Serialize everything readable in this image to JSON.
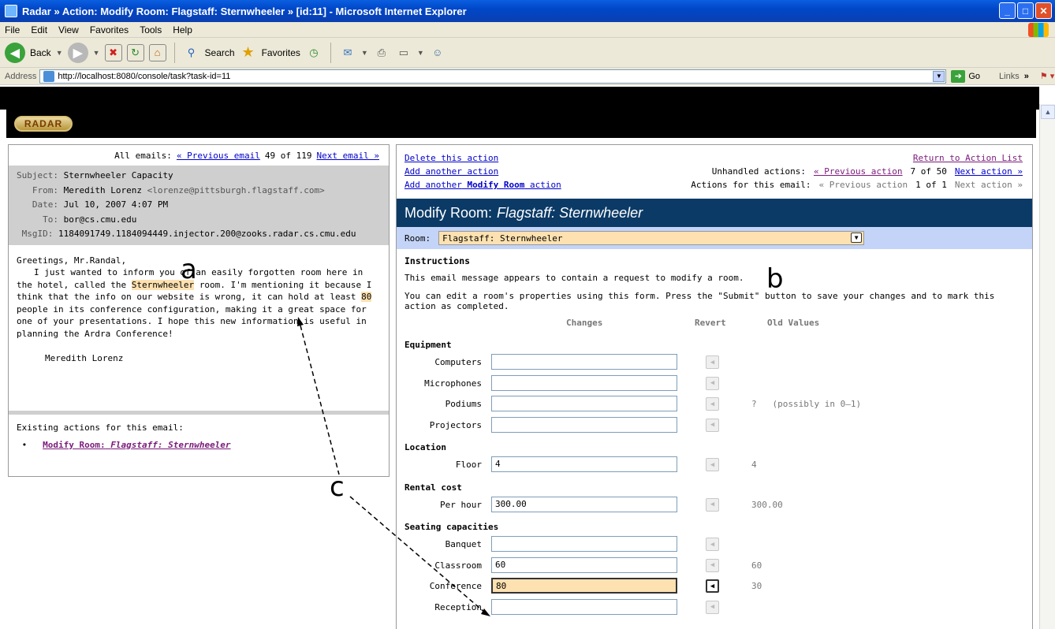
{
  "window": {
    "title": "Radar » Action: Modify Room: Flagstaff: Sternwheeler » [id:11] - Microsoft Internet Explorer"
  },
  "menu": [
    "File",
    "Edit",
    "View",
    "Favorites",
    "Tools",
    "Help"
  ],
  "toolbar": {
    "back": "Back",
    "search": "Search",
    "favorites": "Favorites"
  },
  "address": {
    "label": "Address",
    "url": "http://localhost:8080/console/task?task-id=11",
    "go": "Go",
    "links": "Links"
  },
  "logo": "RADAR",
  "email_pane": {
    "nav": {
      "all_emails": "All emails:",
      "previous": "« Previous email",
      "position": "49 of 119",
      "next": "Next email »"
    },
    "header": {
      "subject_label": "Subject:",
      "subject": "Sternwheeler Capacity",
      "from_label": "From:",
      "from_name": "Meredith Lorenz",
      "from_email": "<lorenze@pittsburgh.flagstaff.com>",
      "date_label": "Date:",
      "date": "Jul 10, 2007 4:07 PM",
      "to_label": "To:",
      "to": "bor@cs.cmu.edu",
      "msgid_label": "MsgID:",
      "msgid": "1184091749.1184094449.injector.200@zooks.radar.cs.cmu.edu"
    },
    "body": {
      "greeting": "Greetings, Mr.Randal,",
      "p1": "I just wanted to inform you of an easily forgotten room here in the hotel, called the",
      "room_highlight": "Sternwheeler",
      "p2": "room.  I'm mentioning it because I think that the info on our website is wrong, it can hold at least",
      "num_highlight": "80",
      "p3": "people in its conference configuration, making it a great space for one of your presentations. I hope this new information is useful in planning the Ardra Conference!",
      "signature": "Meredith Lorenz"
    },
    "existing": {
      "label": "Existing actions for this email:",
      "action_prefix": "Modify Room:",
      "action_name": "Flagstaff: Sternwheeler"
    }
  },
  "action_pane": {
    "links": {
      "delete": "Delete this action",
      "add_another": "Add another action",
      "add_modify_prefix": "Add another",
      "add_modify_bold": "Modify Room",
      "add_modify_suffix": "action"
    },
    "right": {
      "return": "Return to Action List",
      "unhandled_label": "Unhandled actions:",
      "unhandled_prev": "« Previous action",
      "unhandled_pos": "7 of 50",
      "unhandled_next": "Next action »",
      "email_label": "Actions for this email:",
      "email_prev": "« Previous action",
      "email_pos": "1 of 1",
      "email_next": "Next action »"
    },
    "title_prefix": "Modify Room:",
    "title_name": "Flagstaff: Sternwheeler",
    "room_label": "Room:",
    "room_value": "Flagstaff: Sternwheeler",
    "instructions_heading": "Instructions",
    "instr1": "This email message appears to contain a request to modify a room.",
    "instr2": "You can edit a room's properties using this form. Press the \"Submit\" button to save your changes and to mark this action as completed.",
    "columns": {
      "changes": "Changes",
      "revert": "Revert",
      "old": "Old Values"
    },
    "sections": {
      "equipment": "Equipment",
      "location": "Location",
      "rental": "Rental cost",
      "seating": "Seating capacities"
    },
    "fields": {
      "computers": {
        "label": "Computers",
        "value": "",
        "old": ""
      },
      "microphones": {
        "label": "Microphones",
        "value": "",
        "old": ""
      },
      "podiums": {
        "label": "Podiums",
        "value": "",
        "old": "?   (possibly in 0–1)"
      },
      "projectors": {
        "label": "Projectors",
        "value": "",
        "old": ""
      },
      "floor": {
        "label": "Floor",
        "value": "4",
        "old": "4"
      },
      "per_hour": {
        "label": "Per hour",
        "value": "300.00",
        "old": "300.00"
      },
      "banquet": {
        "label": "Banquet",
        "value": "",
        "old": ""
      },
      "classroom": {
        "label": "Classroom",
        "value": "60",
        "old": "60"
      },
      "conference": {
        "label": "Conference",
        "value": "80",
        "old": "30"
      },
      "reception": {
        "label": "Reception",
        "value": "",
        "old": ""
      }
    }
  },
  "annotations": {
    "a": "a",
    "b": "b",
    "c": "c"
  }
}
